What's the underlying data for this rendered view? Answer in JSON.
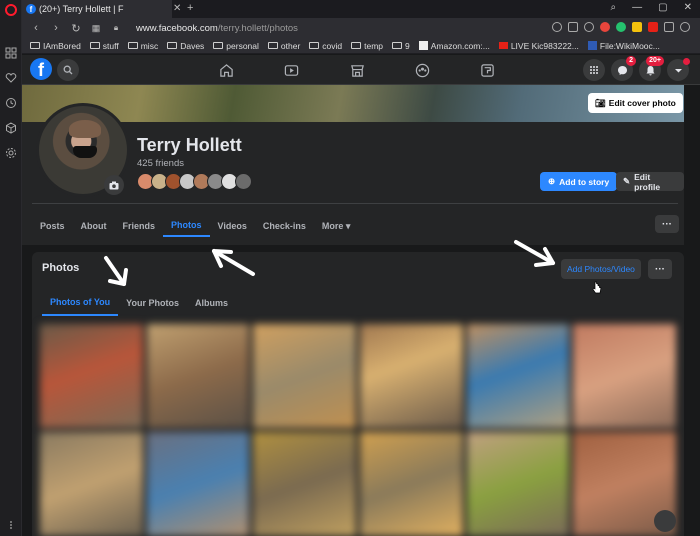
{
  "browser": {
    "tab_title": "(20+) Terry Hollett | F",
    "url_prefix": "www.facebook.com",
    "url_path": "/terry.hollett/photos",
    "tab_count_badge": "f",
    "bookmarks": [
      {
        "label": "IAmBored",
        "type": "folder"
      },
      {
        "label": "stuff",
        "type": "folder"
      },
      {
        "label": "misc",
        "type": "folder"
      },
      {
        "label": "Daves",
        "type": "folder"
      },
      {
        "label": "personal",
        "type": "folder"
      },
      {
        "label": "other",
        "type": "folder"
      },
      {
        "label": "covid",
        "type": "folder"
      },
      {
        "label": "temp",
        "type": "folder"
      },
      {
        "label": "9",
        "type": "folder"
      },
      {
        "label": "Amazon.com:...",
        "type": "link"
      },
      {
        "label": "LIVE Kic983222...",
        "type": "link"
      },
      {
        "label": "File:WikiMooc...",
        "type": "link"
      }
    ]
  },
  "fbnav": {
    "messenger_badge": "2",
    "notifications_badge": "20+"
  },
  "profile": {
    "name": "Terry Hollett",
    "friends_count": "425 friends",
    "edit_cover_label": "Edit cover photo",
    "add_story_label": "Add to story",
    "edit_profile_label": "Edit profile",
    "more_dots": "···",
    "friend_avatar_colors": [
      "#d98b6b",
      "#c9b28a",
      "#a0522d",
      "#c8c8c8",
      "#b07a5a",
      "#8a8a8a",
      "#e0e0e0",
      "#6b6b6b"
    ],
    "tabs": [
      {
        "label": "Posts",
        "active": false
      },
      {
        "label": "About",
        "active": false
      },
      {
        "label": "Friends",
        "active": false
      },
      {
        "label": "Photos",
        "active": true
      },
      {
        "label": "Videos",
        "active": false
      },
      {
        "label": "Check-ins",
        "active": false
      },
      {
        "label": "More ▾",
        "active": false
      }
    ]
  },
  "photos": {
    "title": "Photos",
    "add_label": "Add Photos/Video",
    "dots": "···",
    "tabs": [
      {
        "label": "Photos of You",
        "active": true
      },
      {
        "label": "Your Photos",
        "active": false
      },
      {
        "label": "Albums",
        "active": false
      }
    ],
    "thumb_colors": [
      [
        "#b8563a",
        "#8c6a4a",
        "#d0a060",
        "#a07850",
        "#3a7ab0",
        "#c07a60"
      ],
      [
        "#c0a070",
        "#4a80b0",
        "#b09040",
        "#d0a050",
        "#8aa040",
        "#a06040"
      ]
    ]
  },
  "colors": {
    "accent": "#2d88ff",
    "fb_blue": "#1877f2",
    "badge_red": "#e41e3f"
  }
}
